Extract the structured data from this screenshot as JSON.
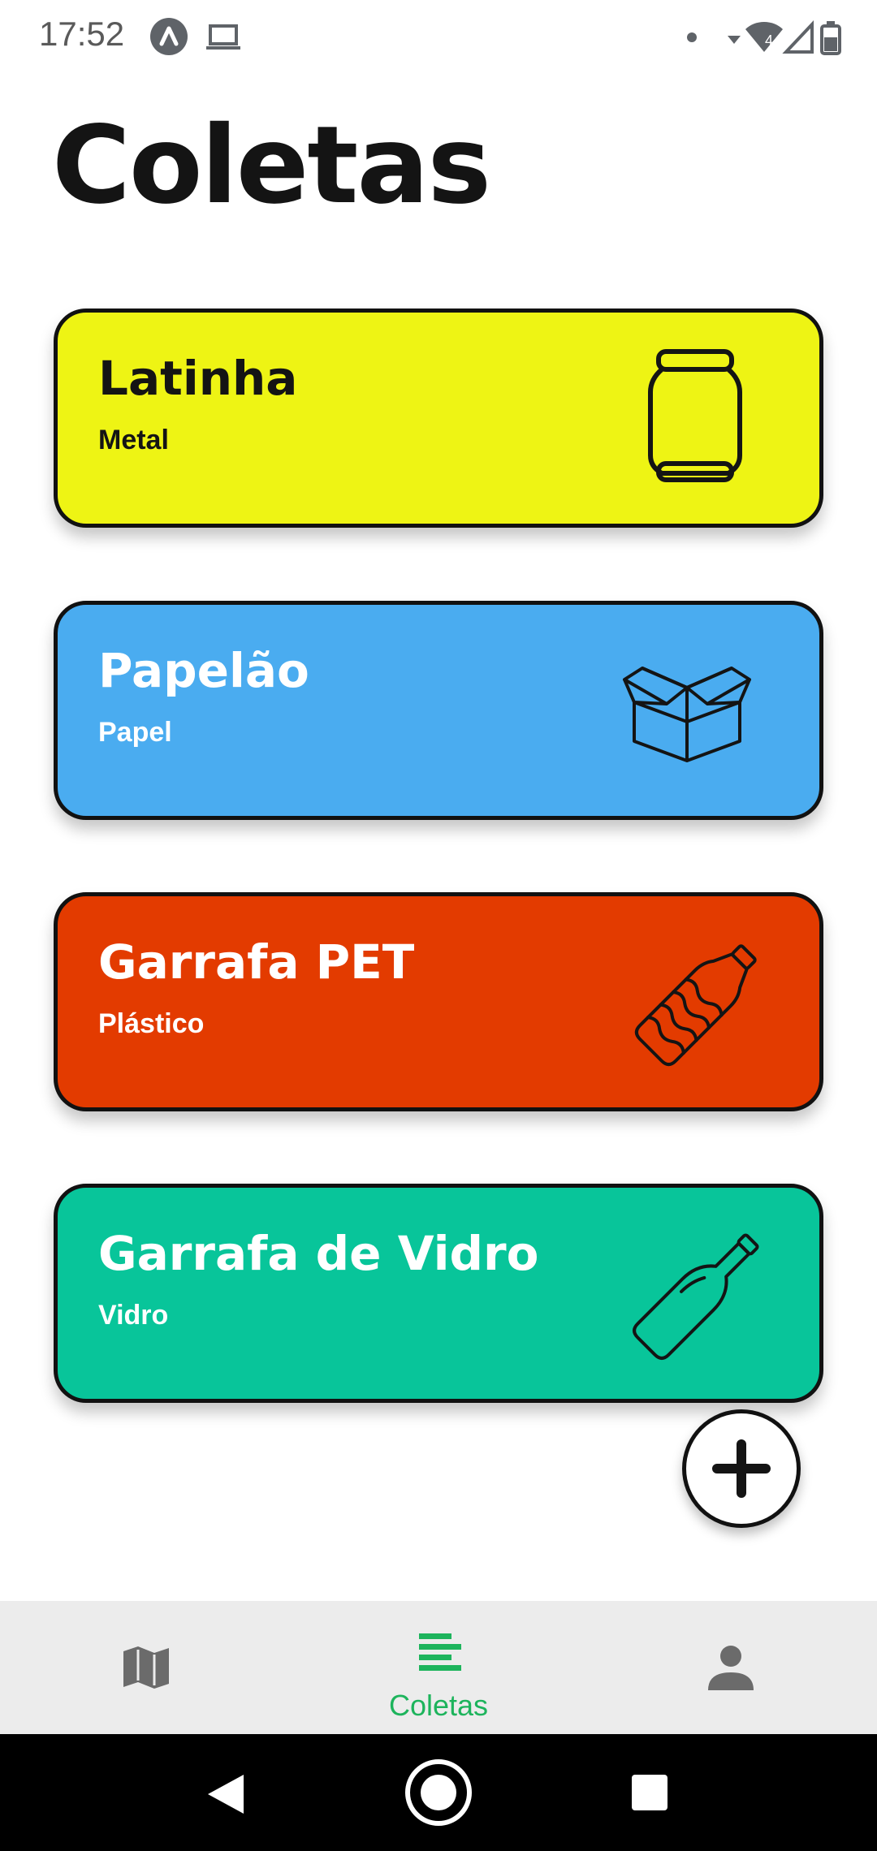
{
  "status_bar": {
    "time": "17:52",
    "icons": [
      "app-notification-icon",
      "laptop-icon",
      "dot-icon",
      "wifi-icon",
      "signal-icon",
      "battery-icon"
    ],
    "wifi_badge": "4"
  },
  "header": {
    "title": "Coletas"
  },
  "cards": [
    {
      "title": "Latinha",
      "subtitle": "Metal",
      "color": "#eef414",
      "icon": "can-icon"
    },
    {
      "title": "Papelão",
      "subtitle": "Papel",
      "color": "#4aacf0",
      "icon": "box-icon"
    },
    {
      "title": "Garrafa PET",
      "subtitle": "Plástico",
      "color": "#e33b00",
      "icon": "plastic-bottle-icon"
    },
    {
      "title": "Garrafa de Vidro",
      "subtitle": "Vidro",
      "color": "#08c59a",
      "icon": "glass-bottle-icon"
    }
  ],
  "fab": {
    "icon": "plus-icon"
  },
  "bottom_nav": {
    "items": [
      {
        "icon": "map-icon",
        "label": ""
      },
      {
        "icon": "list-icon",
        "label": "Coletas",
        "active": true
      },
      {
        "icon": "person-icon",
        "label": ""
      }
    ],
    "active_color": "#1db45c",
    "inactive_color": "#6b6b6b"
  },
  "system_nav": {
    "buttons": [
      "back-icon",
      "home-icon",
      "recents-icon"
    ]
  }
}
